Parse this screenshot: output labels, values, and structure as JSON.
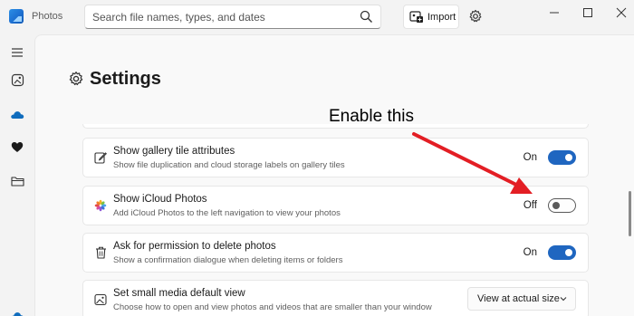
{
  "app": {
    "title": "Photos"
  },
  "search": {
    "placeholder": "Search file names, types, and dates"
  },
  "toolbar": {
    "import_label": "Import"
  },
  "page": {
    "title": "Settings"
  },
  "settings": [
    {
      "title": "Show gallery tile attributes",
      "description": "Show file duplication and cloud storage labels on gallery tiles",
      "state": "On",
      "icon": "edit-icon"
    },
    {
      "title": "Show iCloud Photos",
      "description": "Add iCloud Photos to the left navigation to view your photos",
      "state": "Off",
      "icon": "icloud-photos-icon"
    },
    {
      "title": "Ask for permission to delete photos",
      "description": "Show a confirmation dialogue when deleting items or folders",
      "state": "On",
      "icon": "trash-icon"
    },
    {
      "title": "Set small media default view",
      "description": "Choose how to open and view photos and videos that are smaller than your window",
      "dropdown_value": "View at actual size",
      "icon": "image-icon"
    }
  ],
  "annotation": {
    "text": "Enable this",
    "arrow_color": "#e31e24"
  },
  "colors": {
    "accent": "#1f66c0",
    "onedrive_blue": "#0f6cbd"
  }
}
